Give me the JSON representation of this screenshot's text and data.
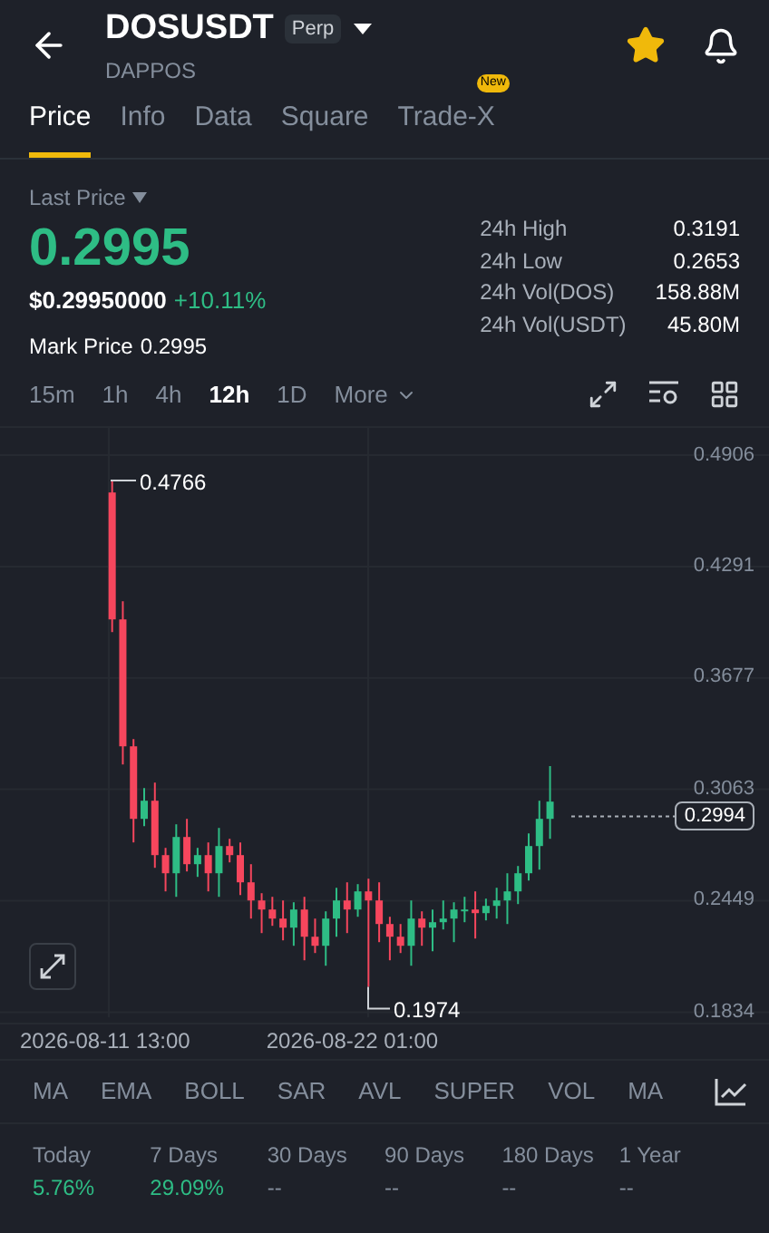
{
  "header": {
    "symbol": "DOSUSDT",
    "contract_badge": "Perp",
    "subtitle": "DAPPOS",
    "favorite": true
  },
  "tabs": [
    {
      "label": "Price",
      "selected": true
    },
    {
      "label": "Info",
      "selected": false
    },
    {
      "label": "Data",
      "selected": false
    },
    {
      "label": "Square",
      "selected": false
    },
    {
      "label": "Trade-X",
      "selected": false,
      "badge": "New"
    }
  ],
  "price": {
    "label": "Last Price",
    "last": "0.2995",
    "usd": "$0.29950000",
    "change": "+10.11%",
    "mark_label": "Mark Price",
    "mark": "0.2995"
  },
  "stats": [
    {
      "label": "24h High",
      "value": "0.3191"
    },
    {
      "label": "24h Low",
      "value": "0.2653"
    },
    {
      "label": "24h Vol(DOS)",
      "value": "158.88M"
    },
    {
      "label": "24h Vol(USDT)",
      "value": "45.80M"
    }
  ],
  "intervals": [
    {
      "label": "15m",
      "selected": false
    },
    {
      "label": "1h",
      "selected": false
    },
    {
      "label": "4h",
      "selected": false
    },
    {
      "label": "12h",
      "selected": true
    },
    {
      "label": "1D",
      "selected": false
    },
    {
      "label": "More",
      "selected": false
    }
  ],
  "chart": {
    "chart_data": {
      "type": "candlestick",
      "grid": true,
      "ylim": [
        0.0616,
        0.7416
      ],
      "categories": [
        null,
        null,
        null,
        null,
        null,
        null,
        null,
        null,
        null,
        null,
        null,
        null,
        null,
        null,
        null,
        null,
        null,
        null,
        null,
        null,
        null,
        null,
        null,
        null,
        null,
        null,
        null,
        null,
        null,
        null,
        null,
        null,
        null,
        null,
        null,
        null,
        null,
        null,
        null,
        null,
        null,
        null,
        null,
        null,
        null,
        null,
        null,
        null,
        null,
        null,
        null,
        null,
        null,
        null,
        null,
        null,
        null,
        null,
        null,
        null,
        null,
        null,
        null,
        null,
        null,
        null,
        null,
        null,
        null,
        null,
        null,
        null
      ],
      "yticks": [
        0.4906,
        0.4291,
        0.3677,
        0.3063,
        0.2449,
        0.1834
      ],
      "ohlc": [
        null,
        null,
        null,
        null,
        null,
        null,
        null,
        null,
        null,
        null,
        [
          0.47,
          0.4766,
          0.393,
          0.4
        ],
        [
          0.4,
          0.41,
          0.32,
          0.33
        ],
        [
          0.33,
          0.334,
          0.277,
          0.29
        ],
        [
          0.29,
          0.307,
          0.286,
          0.3
        ],
        [
          0.3,
          0.31,
          0.263,
          0.27
        ],
        [
          0.27,
          0.274,
          0.25,
          0.26
        ],
        [
          0.26,
          0.287,
          0.247,
          0.28
        ],
        [
          0.28,
          0.29,
          0.261,
          0.265
        ],
        [
          0.265,
          0.274,
          0.258,
          0.27
        ],
        [
          0.27,
          0.277,
          0.25,
          0.26
        ],
        [
          0.26,
          0.285,
          0.247,
          0.275
        ],
        [
          0.275,
          0.279,
          0.266,
          0.27
        ],
        [
          0.27,
          0.277,
          0.248,
          0.255
        ],
        [
          0.255,
          0.265,
          0.235,
          0.245
        ],
        [
          0.245,
          0.249,
          0.227,
          0.24
        ],
        [
          0.24,
          0.247,
          0.231,
          0.235
        ],
        [
          0.235,
          0.245,
          0.223,
          0.23
        ],
        [
          0.23,
          0.244,
          0.22,
          0.24
        ],
        [
          0.24,
          0.247,
          0.212,
          0.225
        ],
        [
          0.225,
          0.235,
          0.216,
          0.22
        ],
        [
          0.22,
          0.239,
          0.209,
          0.235
        ],
        [
          0.235,
          0.252,
          0.225,
          0.245
        ],
        [
          0.245,
          0.255,
          0.227,
          0.24
        ],
        [
          0.24,
          0.254,
          0.236,
          0.25
        ],
        [
          0.25,
          0.257,
          0.1974,
          0.245
        ],
        [
          0.245,
          0.255,
          0.222,
          0.232
        ],
        [
          0.232,
          0.236,
          0.212,
          0.225
        ],
        [
          0.225,
          0.232,
          0.216,
          0.22
        ],
        [
          0.22,
          0.245,
          0.209,
          0.235
        ],
        [
          0.235,
          0.239,
          0.22,
          0.23
        ],
        [
          0.23,
          0.24,
          0.217,
          0.233
        ],
        [
          0.233,
          0.245,
          0.229,
          0.235
        ],
        [
          0.235,
          0.244,
          0.222,
          0.24
        ],
        [
          0.24,
          0.247,
          0.233,
          0.24
        ],
        [
          0.24,
          0.25,
          0.224,
          0.238
        ],
        [
          0.238,
          0.246,
          0.234,
          0.242
        ],
        [
          0.242,
          0.252,
          0.235,
          0.245
        ],
        [
          0.245,
          0.26,
          0.232,
          0.25
        ],
        [
          0.25,
          0.264,
          0.243,
          0.26
        ],
        [
          0.26,
          0.282,
          0.256,
          0.275
        ],
        [
          0.275,
          0.3,
          0.262,
          0.29
        ],
        [
          0.29,
          0.3191,
          0.279,
          0.2995
        ],
        null,
        null,
        null,
        null,
        null,
        null,
        null,
        null,
        null,
        null,
        null,
        null,
        null,
        null,
        null,
        null,
        null,
        null,
        null,
        null
      ]
    },
    "y_labels": [
      "0.4906",
      "0.4291",
      "0.3677",
      "0.3063",
      "0.2449",
      "0.1834"
    ],
    "high_marker": "0.4766",
    "low_marker": "0.1974",
    "current_price": "0.2994",
    "x_labels": [
      "2026-08-11 13:00",
      "2026-08-22 01:00"
    ]
  },
  "indicators": [
    "MA",
    "EMA",
    "BOLL",
    "SAR",
    "AVL",
    "SUPER",
    "VOL",
    "MA"
  ],
  "performance": [
    {
      "period": "Today",
      "value": "5.76%"
    },
    {
      "period": "7 Days",
      "value": "29.09%"
    },
    {
      "period": "30 Days",
      "value": "--"
    },
    {
      "period": "90 Days",
      "value": "--"
    },
    {
      "period": "180 Days",
      "value": "--"
    },
    {
      "period": "1 Year",
      "value": "--"
    }
  ]
}
